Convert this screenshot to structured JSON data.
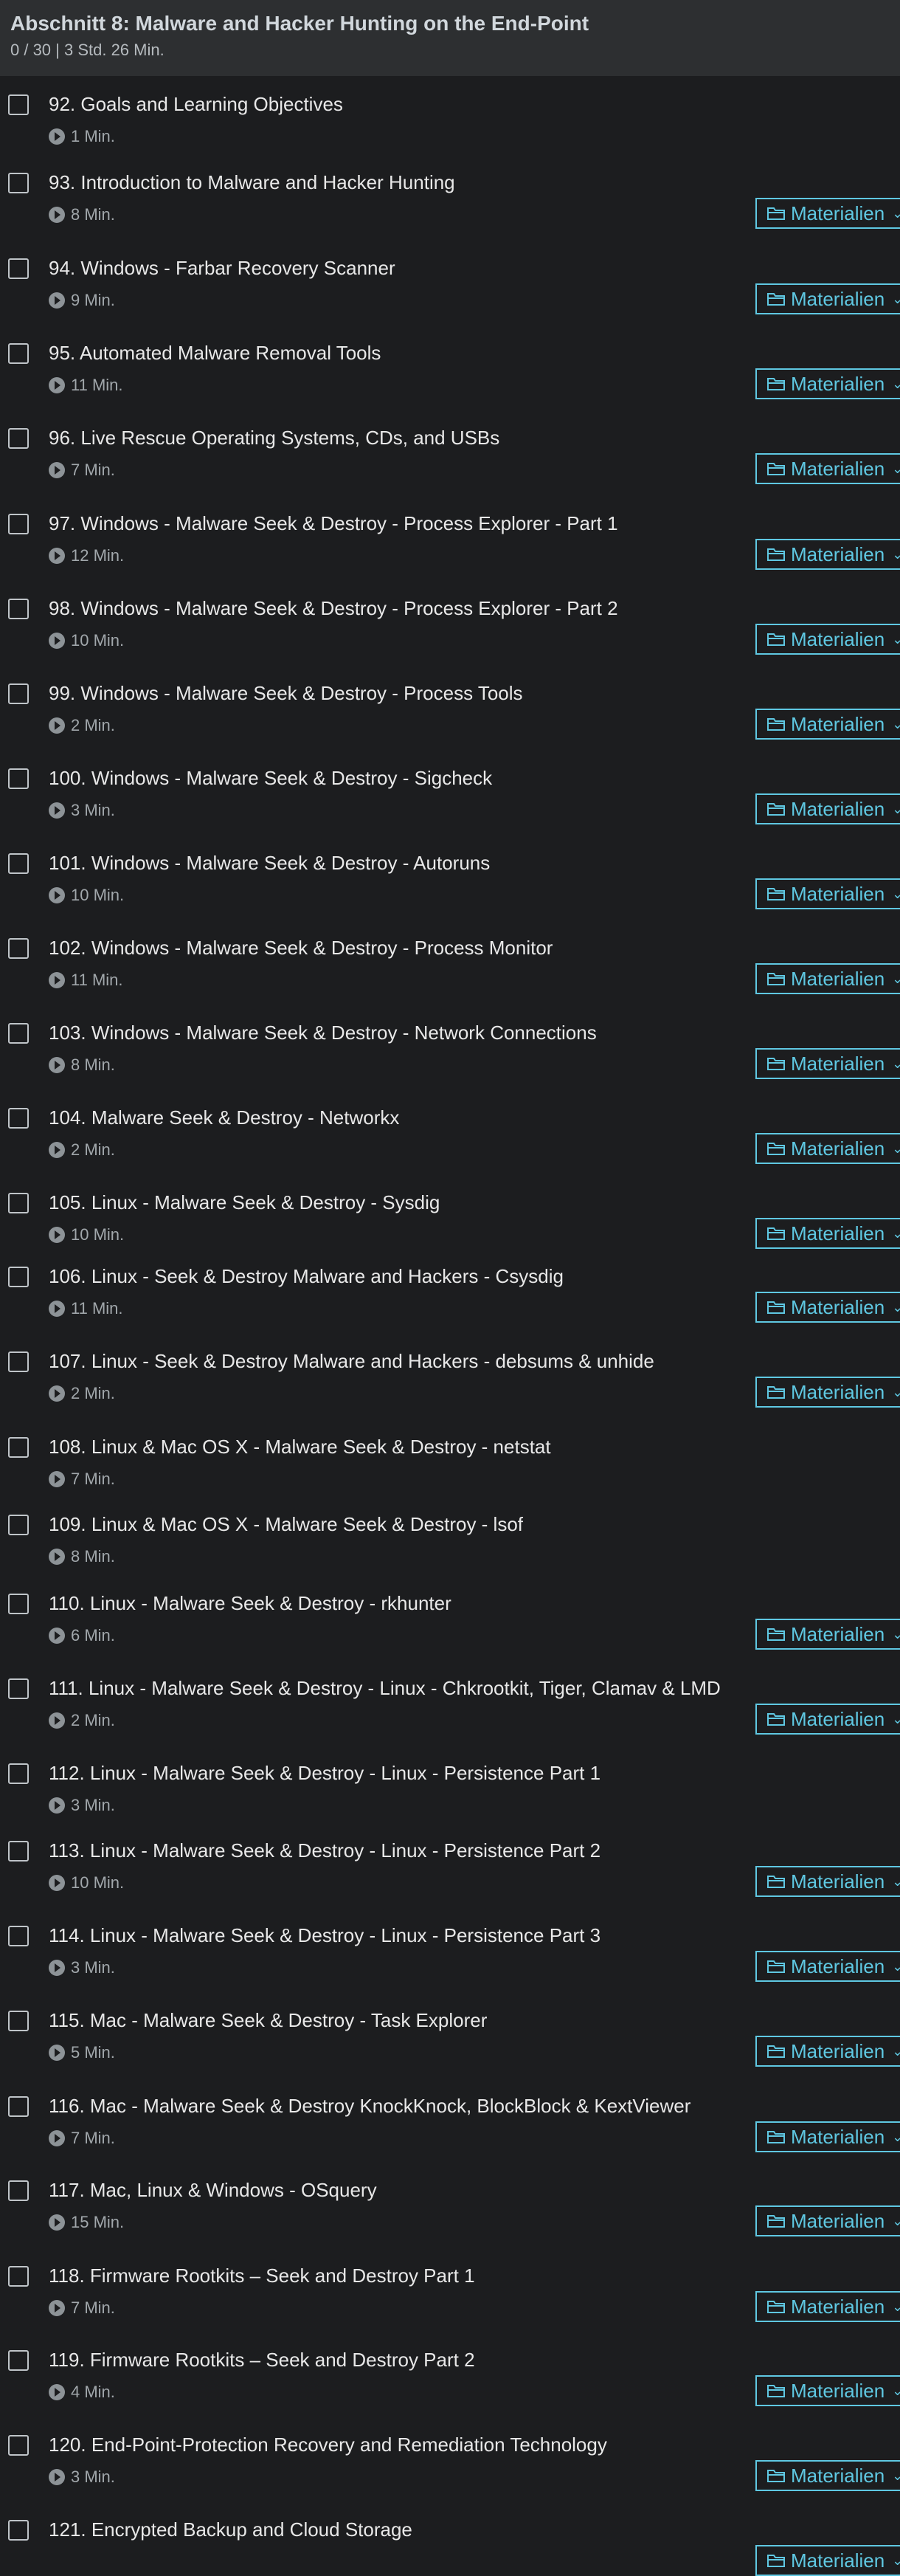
{
  "section": {
    "title": "Abschnitt 8: Malware and Hacker Hunting on the End-Point",
    "meta": "0 / 30 | 3 Std. 26 Min."
  },
  "resources_label": "Materialien",
  "items": [
    {
      "title": "92. Goals and Learning Objectives",
      "duration": "1 Min.",
      "resources": false
    },
    {
      "title": "93. Introduction to Malware and Hacker Hunting",
      "duration": "8 Min.",
      "resources": true
    },
    {
      "title": "94. Windows - Farbar Recovery Scanner",
      "duration": "9 Min.",
      "resources": true
    },
    {
      "title": "95. Automated Malware Removal Tools",
      "duration": "11 Min.",
      "resources": true
    },
    {
      "title": "96. Live Rescue Operating Systems, CDs, and USBs",
      "duration": "7 Min.",
      "resources": true
    },
    {
      "title": "97. Windows - Malware Seek & Destroy - Process Explorer - Part 1",
      "duration": "12 Min.",
      "resources": true
    },
    {
      "title": "98. Windows - Malware Seek & Destroy - Process Explorer - Part 2",
      "duration": "10 Min.",
      "resources": true
    },
    {
      "title": "99. Windows - Malware Seek & Destroy - Process Tools",
      "duration": "2 Min.",
      "resources": true
    },
    {
      "title": "100. Windows - Malware Seek & Destroy - Sigcheck",
      "duration": "3 Min.",
      "resources": true
    },
    {
      "title": "101. Windows - Malware Seek & Destroy - Autoruns",
      "duration": "10 Min.",
      "resources": true
    },
    {
      "title": "102. Windows - Malware Seek & Destroy - Process Monitor",
      "duration": "11 Min.",
      "resources": true
    },
    {
      "title": "103. Windows - Malware Seek & Destroy - Network Connections",
      "duration": "8 Min.",
      "resources": true
    },
    {
      "title": "104. Malware Seek & Destroy - Networkx",
      "duration": "2 Min.",
      "resources": true
    },
    {
      "title": "105. Linux - Malware Seek & Destroy - Sysdig",
      "duration": "10 Min.",
      "resources": true
    },
    {
      "title": "106. Linux - Seek & Destroy Malware and Hackers - Csysdig",
      "duration": "11 Min.",
      "resources": true
    },
    {
      "title": "107. Linux - Seek & Destroy Malware and Hackers - debsums & unhide",
      "duration": "2 Min.",
      "resources": true
    },
    {
      "title": "108. Linux & Mac OS X - Malware Seek & Destroy - netstat",
      "duration": "7 Min.",
      "resources": false
    },
    {
      "title": "109. Linux & Mac OS X - Malware Seek & Destroy - lsof",
      "duration": "8 Min.",
      "resources": false
    },
    {
      "title": "110. Linux - Malware Seek & Destroy - rkhunter",
      "duration": "6 Min.",
      "resources": true
    },
    {
      "title": "111. Linux - Malware Seek & Destroy - Linux - Chkrootkit, Tiger, Clamav & LMD",
      "duration": "2 Min.",
      "resources": true
    },
    {
      "title": "112. Linux - Malware Seek & Destroy - Linux - Persistence Part 1",
      "duration": "3 Min.",
      "resources": false
    },
    {
      "title": "113. Linux - Malware Seek & Destroy - Linux - Persistence Part 2",
      "duration": "10 Min.",
      "resources": true
    },
    {
      "title": "114. Linux - Malware Seek & Destroy - Linux - Persistence Part 3",
      "duration": "3 Min.",
      "resources": true
    },
    {
      "title": "115. Mac - Malware Seek & Destroy - Task Explorer",
      "duration": "5 Min.",
      "resources": true
    },
    {
      "title": "116. Mac - Malware Seek & Destroy KnockKnock, BlockBlock & KextViewer",
      "duration": "7 Min.",
      "resources": true
    },
    {
      "title": "117. Mac, Linux & Windows - OSquery",
      "duration": "15 Min.",
      "resources": true
    },
    {
      "title": "118. Firmware Rootkits – Seek and Destroy Part 1",
      "duration": "7 Min.",
      "resources": true
    },
    {
      "title": "119. Firmware Rootkits – Seek and Destroy Part 2",
      "duration": "4 Min.",
      "resources": true
    },
    {
      "title": "120. End-Point-Protection Recovery and Remediation Technology",
      "duration": "3 Min.",
      "resources": true
    },
    {
      "title": "121. Encrypted Backup and Cloud Storage",
      "duration": "",
      "resources": true
    }
  ]
}
